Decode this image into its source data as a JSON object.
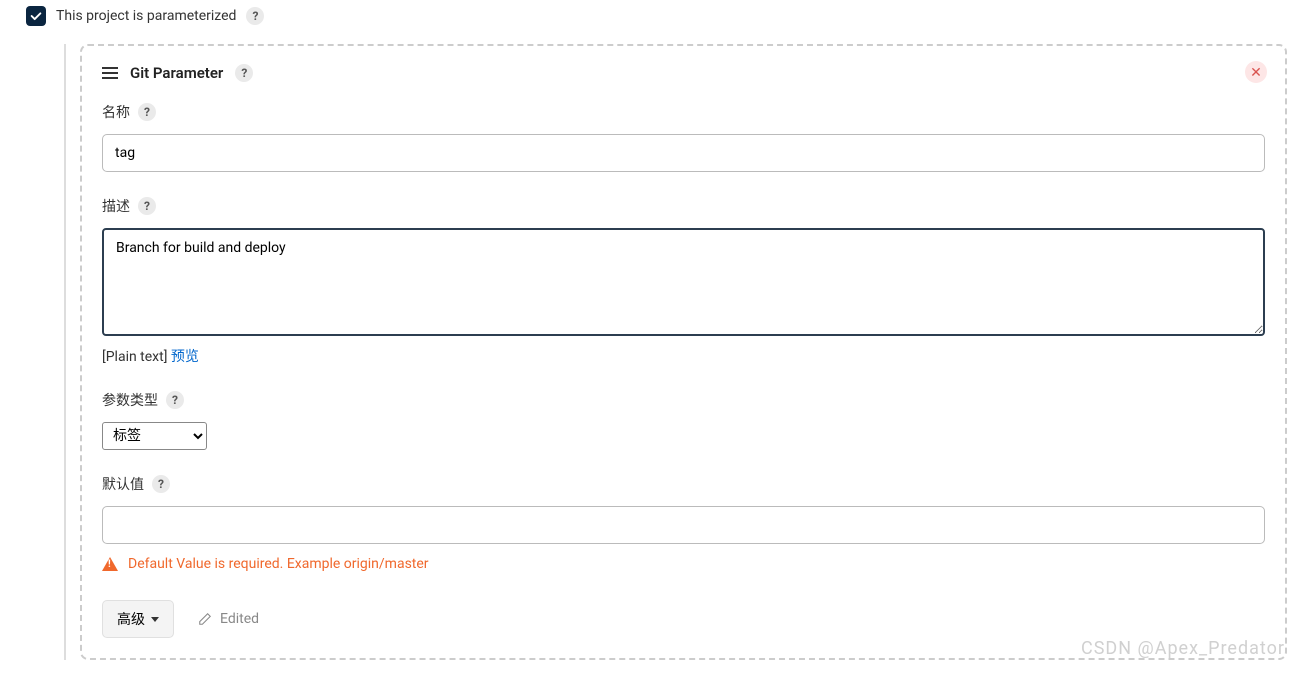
{
  "topCheckbox": {
    "checked": true,
    "label": "This project is parameterized"
  },
  "parameter": {
    "title": "Git Parameter",
    "fields": {
      "name": {
        "label": "名称",
        "value": "tag"
      },
      "description": {
        "label": "描述",
        "value": "Branch for build and deploy",
        "hintPrefix": "[Plain text] ",
        "previewLink": "预览"
      },
      "type": {
        "label": "参数类型",
        "selected": "标签",
        "options": [
          "标签"
        ]
      },
      "defaultValue": {
        "label": "默认值",
        "value": "",
        "warning": "Default Value is required. Example origin/master"
      }
    },
    "footer": {
      "advancedLabel": "高级",
      "editedLabel": "Edited"
    }
  },
  "watermark": "CSDN @Apex_Predator"
}
